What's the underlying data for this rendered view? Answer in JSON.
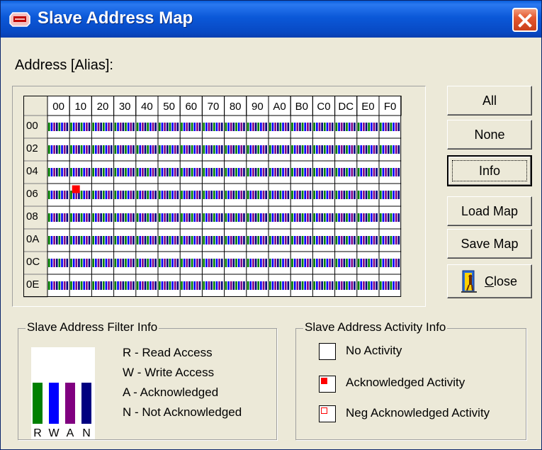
{
  "window": {
    "title": "Slave Address Map",
    "title_icon": "i2c-bus-icon",
    "close_icon": "close-x-icon"
  },
  "address_label": "Address [Alias]:",
  "grid": {
    "corner": "",
    "columns": [
      "00",
      "10",
      "20",
      "30",
      "40",
      "50",
      "60",
      "70",
      "80",
      "90",
      "A0",
      "B0",
      "C0",
      "DC",
      "E0",
      "F0"
    ],
    "rows": [
      "00",
      "02",
      "04",
      "06",
      "08",
      "0A",
      "0C",
      "0E"
    ],
    "bar_colors": [
      "#008000",
      "#0000ff",
      "#800080",
      "#000080"
    ],
    "activity": [
      {
        "row": "06",
        "column": "10",
        "state": "acknowledged"
      }
    ]
  },
  "buttons": {
    "all": "All",
    "none": "None",
    "info": "Info",
    "load_map": "Load Map",
    "save_map": "Save Map",
    "close_prefix": "",
    "close_underline": "C",
    "close_rest": "lose",
    "close_icon": "door-exit-icon"
  },
  "filter_info": {
    "title": "Slave Address Filter Info",
    "bar_letters": [
      "R",
      "W",
      "A",
      "N"
    ],
    "bar_colors": [
      "#008000",
      "#0000ff",
      "#800080",
      "#000080"
    ],
    "items": [
      "R - Read Access",
      "W - Write Access",
      "A - Acknowledged",
      "N - Not Acknowledged"
    ]
  },
  "activity_info": {
    "title": "Slave Address Activity Info",
    "items": [
      {
        "label": "No Activity",
        "state": "none"
      },
      {
        "label": "Acknowledged Activity",
        "state": "acknowledged"
      },
      {
        "label": "Neg Acknowledged Activity",
        "state": "neg-acknowledged"
      }
    ],
    "ack_color": "#ff0000"
  }
}
